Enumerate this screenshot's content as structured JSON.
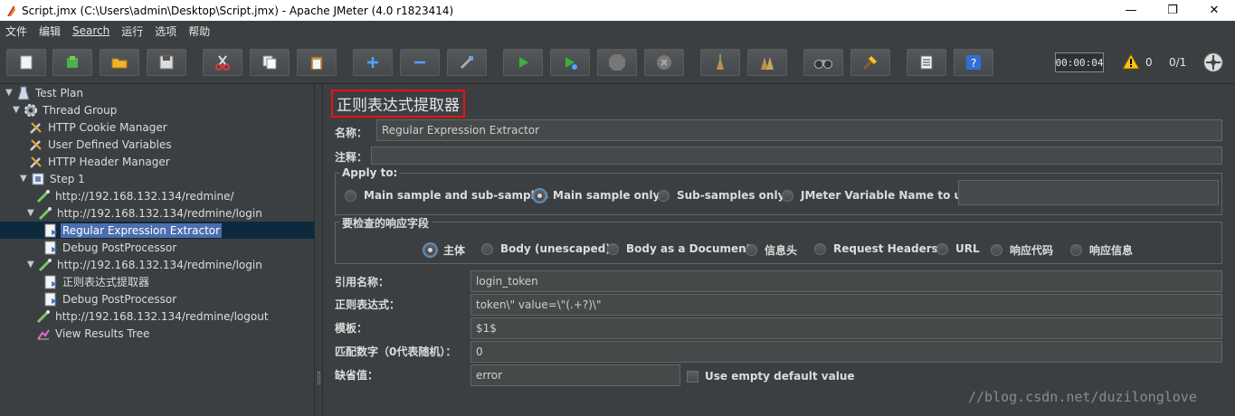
{
  "window": {
    "title": "Script.jmx (C:\\Users\\admin\\Desktop\\Script.jmx) - Apache JMeter (4.0 r1823414)",
    "minimize": "—",
    "maximize": "❐",
    "close": "✕"
  },
  "menu": [
    "文件",
    "编辑",
    "Search",
    "运行",
    "选项",
    "帮助"
  ],
  "toolbar": {
    "timer": "00:00:04",
    "warning_count": "0",
    "threads": "0/1",
    "buttons": [
      "new-icon",
      "templates-icon",
      "open-icon",
      "save-icon",
      "cut-icon",
      "copy-icon",
      "paste-icon",
      "expand-icon",
      "collapse-icon",
      "toggle-icon",
      "start-icon",
      "start-no-pause-icon",
      "stop-icon",
      "shutdown-icon",
      "clear-icon",
      "clear-all-icon",
      "search-icon",
      "reset-search-icon",
      "function-helper-icon",
      "help-icon"
    ]
  },
  "tree": [
    {
      "label": "Test Plan",
      "icon": "test-plan-icon",
      "toggle": "▼"
    },
    {
      "label": "Thread Group",
      "icon": "gear-icon",
      "toggle": "▼"
    },
    {
      "label": "HTTP Cookie Manager",
      "icon": "wrench-icon",
      "toggle": ""
    },
    {
      "label": "User Defined Variables",
      "icon": "wrench-icon",
      "toggle": ""
    },
    {
      "label": "HTTP Header Manager",
      "icon": "wrench-icon",
      "toggle": ""
    },
    {
      "label": "Step 1",
      "icon": "controller-icon",
      "toggle": "▼"
    },
    {
      "label": "http://192.168.132.134/redmine/",
      "icon": "sampler-icon",
      "toggle": ""
    },
    {
      "label": "http://192.168.132.134/redmine/login",
      "icon": "sampler-icon",
      "toggle": "▼"
    },
    {
      "label": "Regular Expression Extractor",
      "icon": "post-processor-icon",
      "toggle": "",
      "selected": true
    },
    {
      "label": "Debug PostProcessor",
      "icon": "post-processor-icon",
      "toggle": ""
    },
    {
      "label": "http://192.168.132.134/redmine/login",
      "icon": "sampler-icon",
      "toggle": "▼"
    },
    {
      "label": "正则表达式提取器",
      "icon": "post-processor-icon",
      "toggle": ""
    },
    {
      "label": "Debug PostProcessor",
      "icon": "post-processor-icon",
      "toggle": ""
    },
    {
      "label": "http://192.168.132.134/redmine/logout",
      "icon": "sampler-icon",
      "toggle": ""
    },
    {
      "label": "View Results Tree",
      "icon": "listener-icon",
      "toggle": ""
    }
  ],
  "panel": {
    "heading": "正则表达式提取器",
    "name_label": "名称：",
    "name_value": "Regular Expression Extractor",
    "comment_label": "注释：",
    "comment_value": "",
    "apply_to": {
      "title": "Apply to:",
      "options": [
        "Main sample and sub-samples",
        "Main sample only",
        "Sub-samples only",
        "JMeter Variable Name to use"
      ],
      "selected": 1,
      "variable_value": ""
    },
    "field_to_check": {
      "title": "要检查的响应字段",
      "options": [
        "主体",
        "Body (unescaped)",
        "Body as a Document",
        "信息头",
        "Request Headers",
        "URL",
        "响应代码",
        "响应信息"
      ],
      "selected": 0
    },
    "ref_name_label": "引用名称：",
    "ref_name_value": "login_token",
    "regex_label": "正则表达式：",
    "regex_value": "token\\\" value=\\\"(.+?)\\\"",
    "template_label": "模板：",
    "template_value": "$1$",
    "match_no_label": "匹配数字（0代表随机）：",
    "match_no_value": "0",
    "default_label": "缺省值：",
    "default_value": "error",
    "use_empty_label": "Use empty default value"
  },
  "watermark": "//blog.csdn.net/duzilonglove"
}
